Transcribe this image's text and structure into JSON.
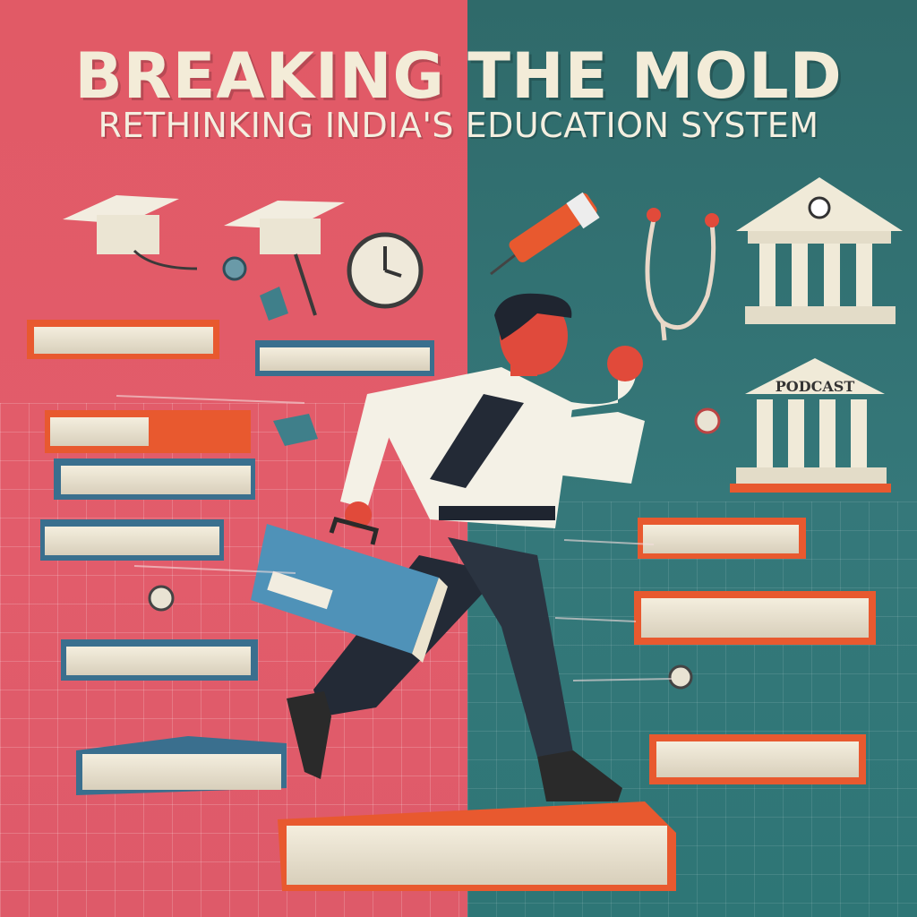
{
  "poster": {
    "title": "BREAKING THE MOLD",
    "subtitle": "RETHINKING INDIA'S EDUCATION SYSTEM",
    "sign_label": "PODCAST"
  },
  "colors": {
    "left_bg": "#e15a66",
    "right_bg": "#2f6a6a",
    "book_orange": "#e8592f",
    "book_blue": "#3a6f8e",
    "cream": "#f3ecd8"
  }
}
